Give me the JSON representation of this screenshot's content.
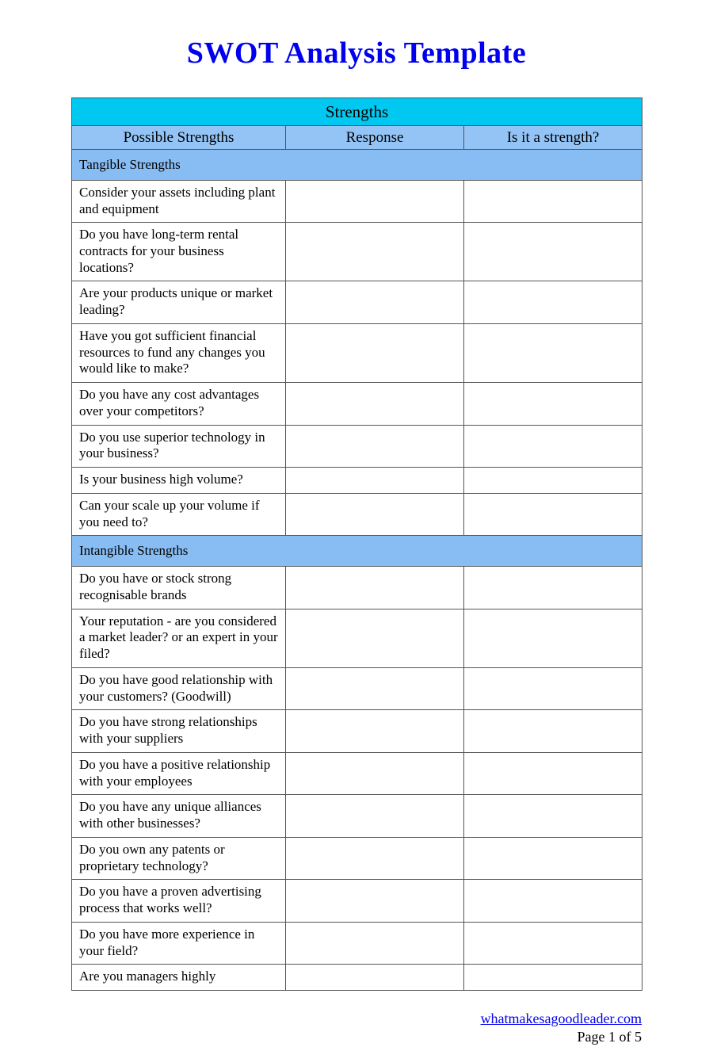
{
  "document": {
    "title": "SWOT Analysis Template"
  },
  "table": {
    "section_title": "Strengths",
    "columns": [
      "Possible Strengths",
      "Response",
      "Is it a strength?"
    ],
    "groups": [
      {
        "label": "Tangible Strengths",
        "questions": [
          "Consider your assets including plant and equipment",
          "Do you have long-term rental contracts for your business locations?",
          "Are your products unique or market leading?",
          "Have you got sufficient financial resources to fund any changes you would like to make?",
          "Do you have any cost advantages over your competitors?",
          "Do you use superior technology in your business?",
          "Is your business high volume?",
          "Can your scale up your volume if you need to?"
        ]
      },
      {
        "label": "Intangible Strengths",
        "questions": [
          "Do you have or stock strong recognisable brands",
          "Your reputation - are you considered a market leader? or an expert in your filed?",
          "Do you have good relationship with your customers? (Goodwill)",
          "Do you have strong relationships with your suppliers",
          "Do you have a positive relationship with your employees",
          "Do you have any unique alliances with other businesses?",
          "Do you own any patents or proprietary technology?",
          "Do you have a proven advertising process that works well?",
          "Do you have more experience in your field?",
          "Are you managers highly"
        ]
      }
    ]
  },
  "footer": {
    "site": "whatmakesagoodleader.com",
    "page": "Page 1 of 5"
  },
  "colors": {
    "title_text": "#0000ee",
    "band_title": "#00c8f0",
    "band_column_header": "#93c4f5",
    "band_section": "#88bdf4",
    "border": "#555555",
    "link": "#0000ee"
  }
}
